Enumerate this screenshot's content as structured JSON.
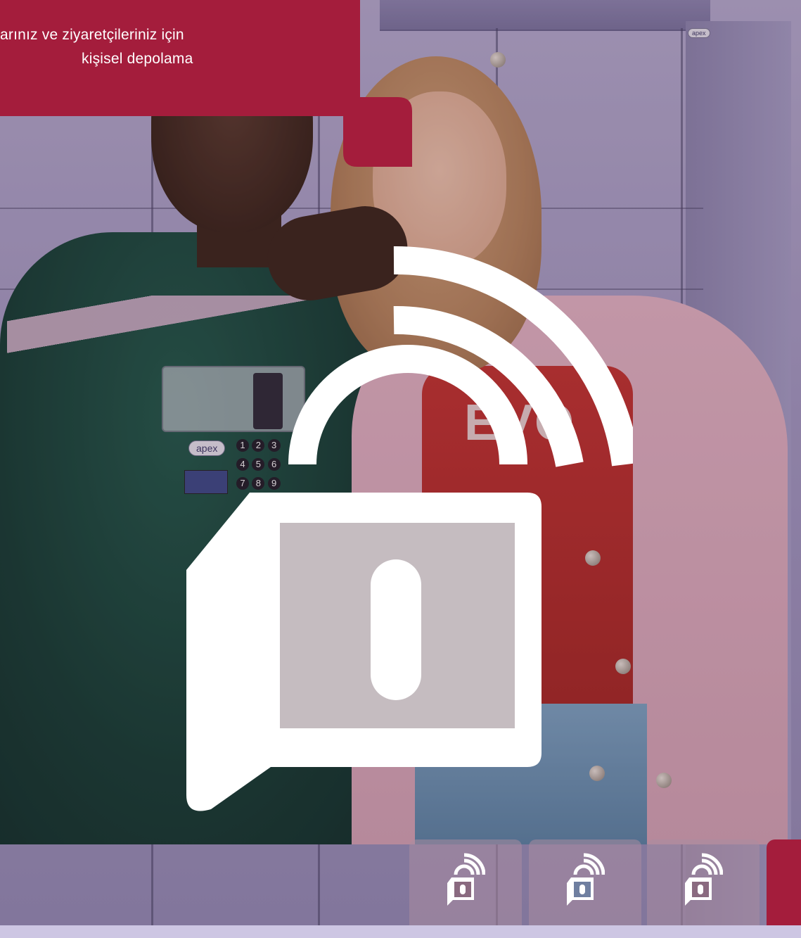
{
  "banner": {
    "line1": "arınız ve ziyaretçileriniz için",
    "line2": "kişisel depolama",
    "color": "#a41d3c"
  },
  "locker": {
    "brand": "apex",
    "brand_small": "apex",
    "keypad_keys": [
      "1",
      "2",
      "3",
      "4",
      "5",
      "6",
      "7",
      "8",
      "9"
    ],
    "shirt_text": "EVO"
  },
  "icons": {
    "main": "smart-lock-wireless-icon",
    "tiles": [
      "smart-lock-wireless-icon",
      "smart-lock-wireless-icon",
      "smart-lock-wireless-icon"
    ]
  },
  "colors": {
    "brand_red": "#a41d3c",
    "icon_white": "#ffffff",
    "tile_bg": "#aa8ca0"
  }
}
